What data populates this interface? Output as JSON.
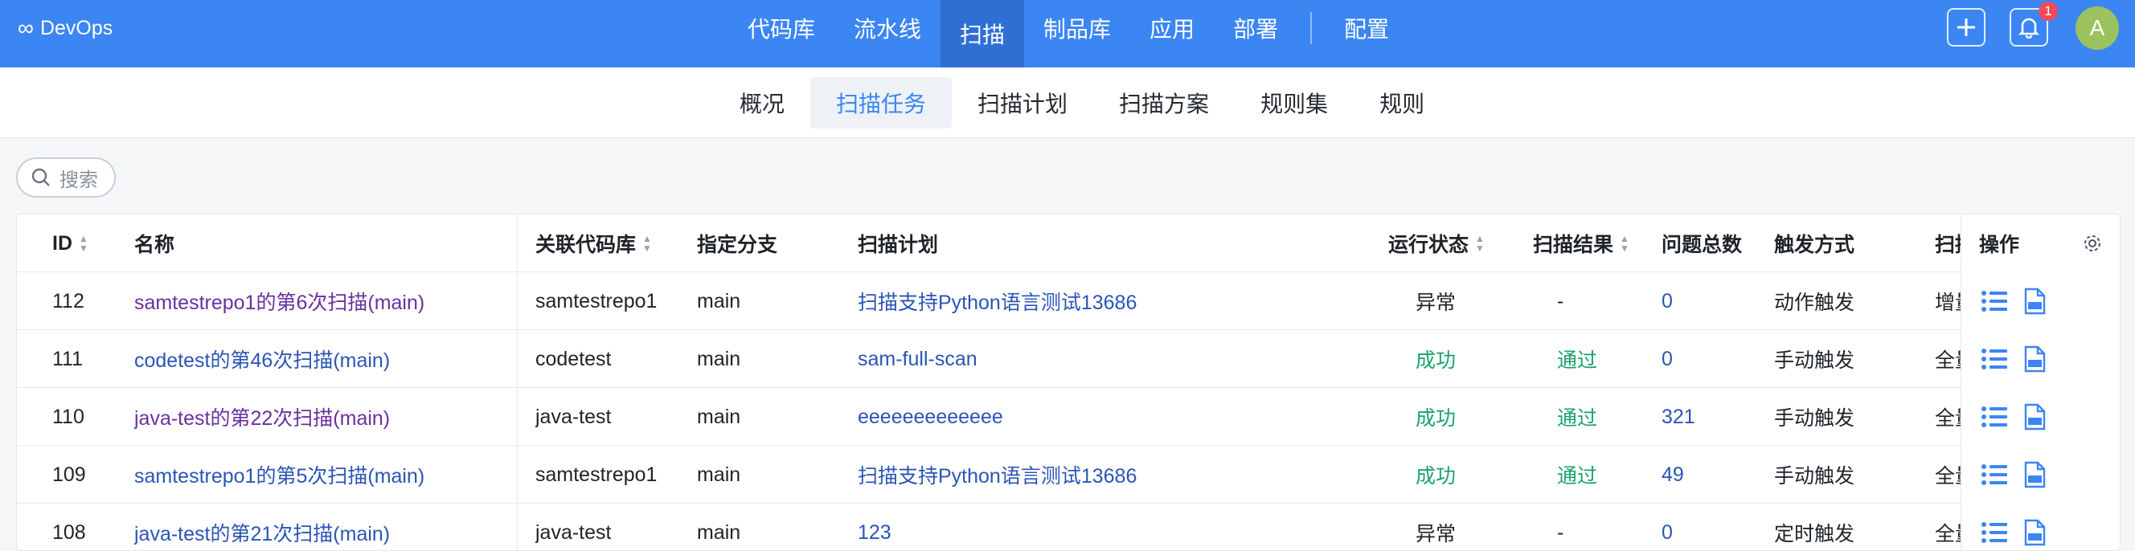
{
  "brand": {
    "name": "DevOps",
    "logo": "∞"
  },
  "topnav": [
    {
      "label": "代码库",
      "active": false
    },
    {
      "label": "流水线",
      "active": false
    },
    {
      "label": "扫描",
      "active": true
    },
    {
      "label": "制品库",
      "active": false
    },
    {
      "label": "应用",
      "active": false
    },
    {
      "label": "部署",
      "active": false
    }
  ],
  "topnav_extra": {
    "label": "配置"
  },
  "notifications": {
    "count": "1"
  },
  "user": {
    "avatar_letter": "A"
  },
  "subtabs": [
    {
      "label": "概况",
      "active": false
    },
    {
      "label": "扫描任务",
      "active": true
    },
    {
      "label": "扫描计划",
      "active": false
    },
    {
      "label": "扫描方案",
      "active": false
    },
    {
      "label": "规则集",
      "active": false
    },
    {
      "label": "规则",
      "active": false
    }
  ],
  "search": {
    "placeholder": "搜索"
  },
  "table": {
    "headers": {
      "id": "ID",
      "name": "名称",
      "repo": "关联代码库",
      "branch": "指定分支",
      "plan": "扫描计划",
      "status": "运行状态",
      "result": "扫描结果",
      "issues": "问题总数",
      "trigger": "触发方式",
      "scope": "扫描",
      "ops": "操作"
    },
    "rows": [
      {
        "id": "112",
        "name": "samtestrepo1的第6次扫描(main)",
        "name_style": "purple",
        "repo": "samtestrepo1",
        "branch": "main",
        "plan": "扫描支持Python语言测试13686",
        "status": "异常",
        "status_style": "normal",
        "result": "-",
        "result_style": "normal",
        "issues": "0",
        "trigger": "动作触发",
        "scope": "增量"
      },
      {
        "id": "111",
        "name": "codetest的第46次扫描(main)",
        "name_style": "blue",
        "repo": "codetest",
        "branch": "main",
        "plan": "sam-full-scan",
        "status": "成功",
        "status_style": "ok",
        "result": "通过",
        "result_style": "ok",
        "issues": "0",
        "trigger": "手动触发",
        "scope": "全量"
      },
      {
        "id": "110",
        "name": "java-test的第22次扫描(main)",
        "name_style": "purple",
        "repo": "java-test",
        "branch": "main",
        "plan": "eeeeeeeeeeeee",
        "status": "成功",
        "status_style": "ok",
        "result": "通过",
        "result_style": "ok",
        "issues": "321",
        "trigger": "手动触发",
        "scope": "全量"
      },
      {
        "id": "109",
        "name": "samtestrepo1的第5次扫描(main)",
        "name_style": "blue",
        "repo": "samtestrepo1",
        "branch": "main",
        "plan": "扫描支持Python语言测试13686",
        "status": "成功",
        "status_style": "ok",
        "result": "通过",
        "result_style": "ok",
        "issues": "49",
        "trigger": "手动触发",
        "scope": "全量"
      },
      {
        "id": "108",
        "name": "java-test的第21次扫描(main)",
        "name_style": "blue",
        "repo": "java-test",
        "branch": "main",
        "plan": "123",
        "status": "异常",
        "status_style": "normal",
        "result": "-",
        "result_style": "normal",
        "issues": "0",
        "trigger": "定时触发",
        "scope": "全量"
      }
    ]
  },
  "colors": {
    "primary": "#3b86f3",
    "success": "#1aa36a",
    "link": "#2a55b6",
    "visited": "#6b2fa0",
    "avatar": "#9bc25f",
    "badge": "#f24957"
  }
}
